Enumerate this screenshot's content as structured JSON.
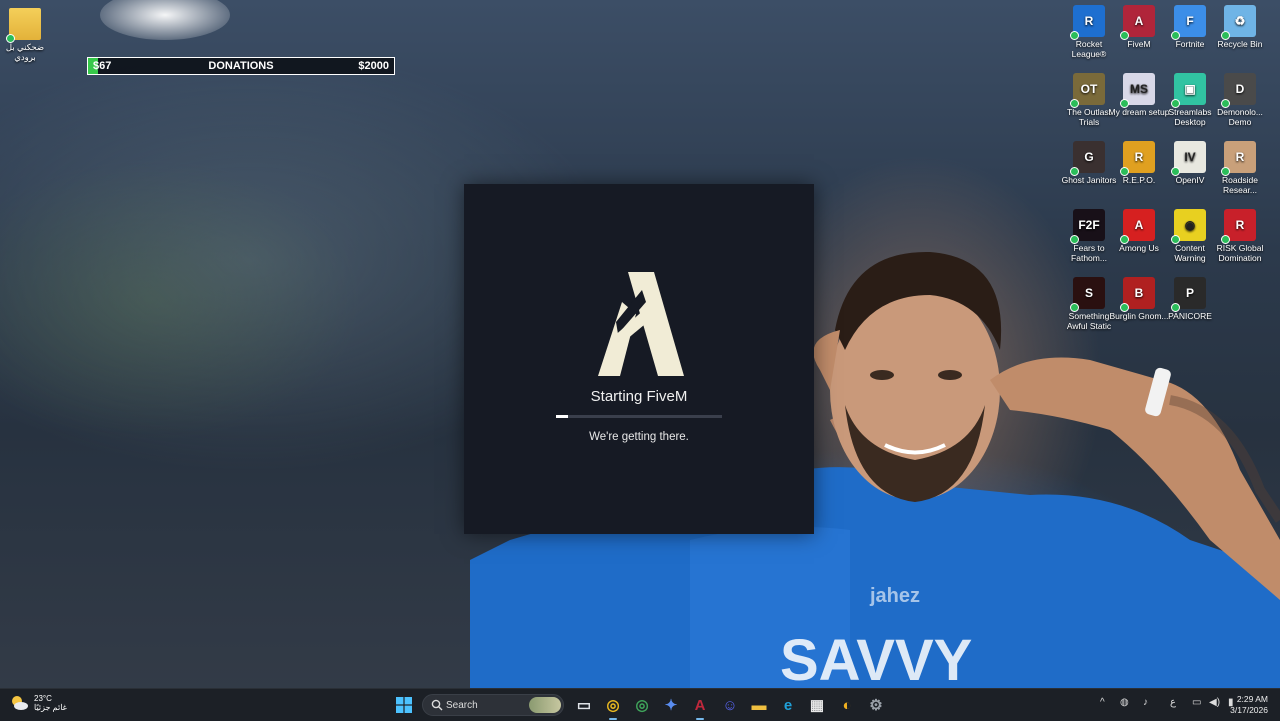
{
  "desktop": {
    "left_icon": {
      "label": "ضحكني بل برودي"
    },
    "icons": [
      {
        "label": "Rocket League®",
        "color": "#1e6fd0",
        "glyph": "R"
      },
      {
        "label": "FiveM",
        "color": "#b0253a",
        "glyph": "A"
      },
      {
        "label": "Fortnite",
        "color": "#3c8ee8",
        "glyph": "F"
      },
      {
        "label": "Recycle Bin",
        "color": "#6fb4e6",
        "glyph": "♻"
      },
      {
        "label": "The Outlast Trials",
        "color": "#7a6a3a",
        "glyph": "OT"
      },
      {
        "label": "My dream setup",
        "color": "#d8d8e8",
        "glyph": "MS"
      },
      {
        "label": "Streamlabs Desktop",
        "color": "#31c3a2",
        "glyph": "▣"
      },
      {
        "label": "Demonolo... Demo",
        "color": "#4a4a4a",
        "glyph": "D"
      },
      {
        "label": "Ghost Janitors",
        "color": "#3a3030",
        "glyph": "G"
      },
      {
        "label": "R.E.P.O.",
        "color": "#e0a020",
        "glyph": "R"
      },
      {
        "label": "OpenIV",
        "color": "#e8e8e0",
        "glyph": "IV"
      },
      {
        "label": "Roadside Resear...",
        "color": "#c9a07a",
        "glyph": "R"
      },
      {
        "label": "Fears to Fathom...",
        "color": "#181018",
        "glyph": "F2F"
      },
      {
        "label": "Among Us",
        "color": "#d62020",
        "glyph": "A"
      },
      {
        "label": "Content Warning",
        "color": "#e8d020",
        "glyph": "◉"
      },
      {
        "label": "RISK Global Domination",
        "color": "#c8202a",
        "glyph": "R"
      },
      {
        "label": "Something Awful Static",
        "color": "#2a1010",
        "glyph": "S"
      },
      {
        "label": "Burglin Gnom...",
        "color": "#b02020",
        "glyph": "B"
      },
      {
        "label": "PANICORE",
        "color": "#2a2a2a",
        "glyph": "P"
      }
    ]
  },
  "donations": {
    "current": "$67",
    "label": "DONATIONS",
    "goal": "$2000",
    "progress": 0.0335,
    "color": "#37c84a"
  },
  "splash": {
    "title": "Starting FiveM",
    "subtitle": "We're getting there.",
    "progress": 0.07
  },
  "taskbar": {
    "weather_temp": "23°C",
    "weather_desc": "غائم جزئيًا",
    "search_placeholder": "Search",
    "apps": [
      {
        "name": "task-view",
        "color": "#dfe3e8",
        "glyph": "▭"
      },
      {
        "name": "chrome",
        "color": "#e9b820",
        "glyph": "◎"
      },
      {
        "name": "chrome-profile",
        "color": "#3fa35a",
        "glyph": "◎"
      },
      {
        "name": "copilot",
        "color": "#5a8df0",
        "glyph": "✦"
      },
      {
        "name": "fivem",
        "color": "#c0283c",
        "glyph": "A"
      },
      {
        "name": "discord",
        "color": "#5865f2",
        "glyph": "☺"
      },
      {
        "name": "file-explorer",
        "color": "#f0c040",
        "glyph": "▬"
      },
      {
        "name": "edge",
        "color": "#1fa0d8",
        "glyph": "e"
      },
      {
        "name": "store",
        "color": "#e8e8e8",
        "glyph": "▦"
      },
      {
        "name": "app-yellow",
        "color": "#f0b020",
        "glyph": "◐"
      },
      {
        "name": "settings",
        "color": "#9aa0a8",
        "glyph": "⚙"
      }
    ],
    "tray_lang": "ع",
    "time": "2:29 AM",
    "date": "3/17/2026"
  }
}
